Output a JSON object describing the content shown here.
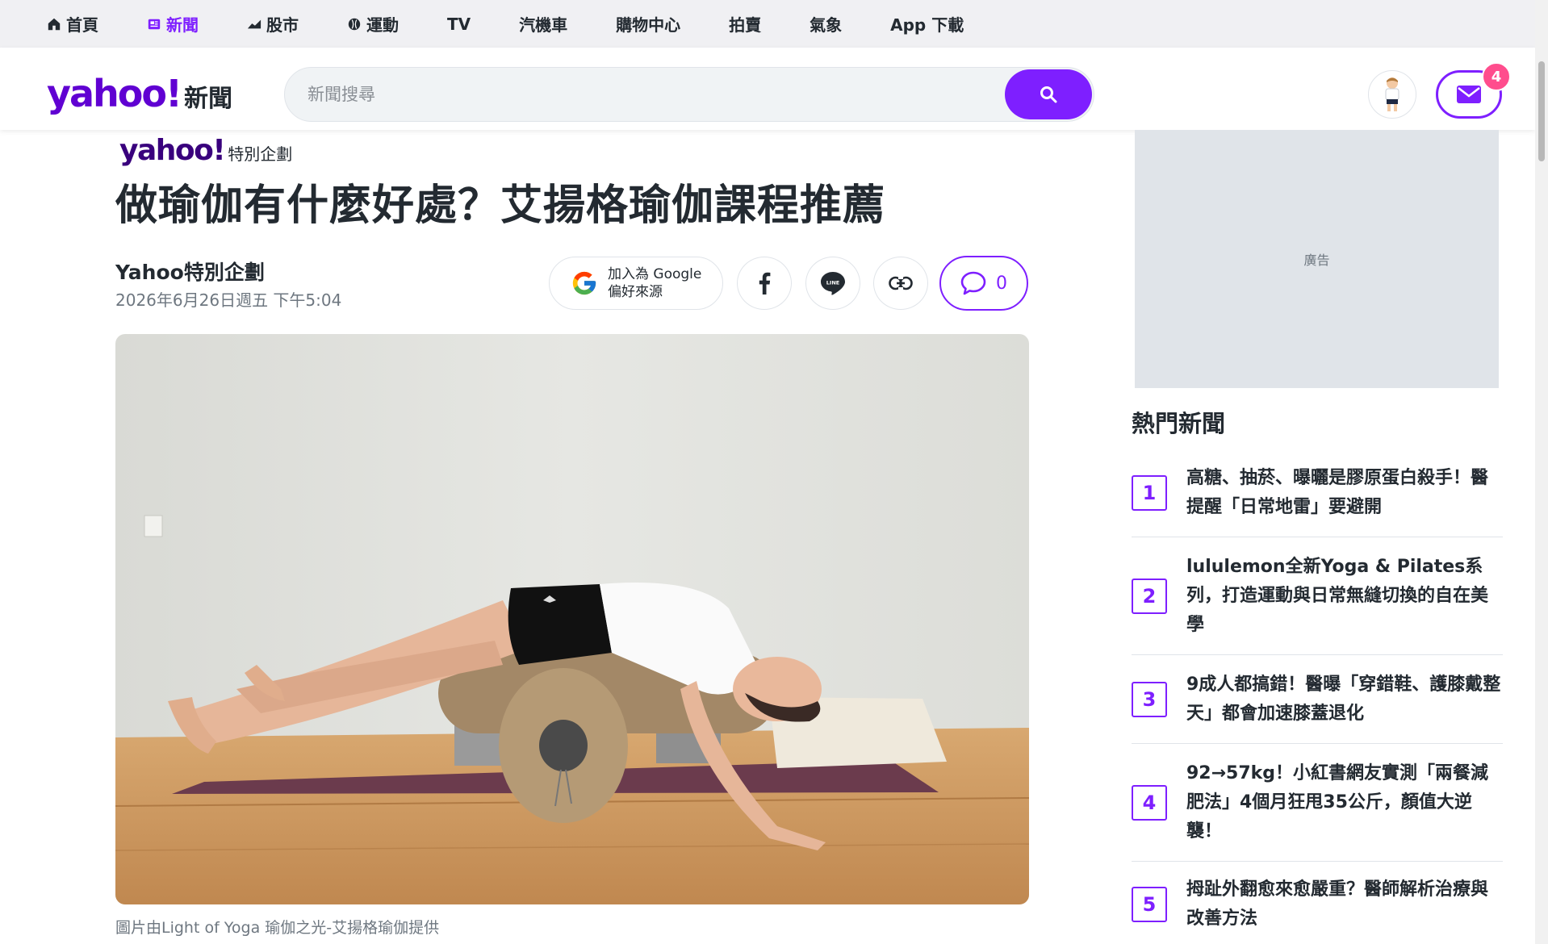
{
  "topnav": {
    "items": [
      {
        "label": "首頁",
        "icon": "home-icon"
      },
      {
        "label": "新聞",
        "icon": "news-icon",
        "active": true
      },
      {
        "label": "股市",
        "icon": "stock-chart-icon"
      },
      {
        "label": "運動",
        "icon": "sports-ball-icon"
      },
      {
        "label": "TV"
      },
      {
        "label": "汽機車"
      },
      {
        "label": "購物中心"
      },
      {
        "label": "拍賣"
      },
      {
        "label": "氣象"
      },
      {
        "label": "App 下載"
      }
    ]
  },
  "header": {
    "logo_text": "yahoo!",
    "logo_sub": "新聞",
    "search_placeholder": "新聞搜尋",
    "mail_badge": "4"
  },
  "article": {
    "brand_logo": "yahoo!",
    "brand_tag": "特別企劃",
    "title": "做瑜伽有什麼好處？艾揚格瑜伽課程推薦",
    "author": "Yahoo特別企劃",
    "date": "2026年6月26日週五 下午5:04",
    "google_line1": "加入為 Google",
    "google_line2": "偏好來源",
    "comment_count": "0",
    "caption": "圖片由Light of Yoga 瑜伽之光-艾揚格瑜伽提供"
  },
  "sidebar": {
    "ad_label": "廣告",
    "trending_title": "熱門新聞",
    "trending": [
      {
        "num": "1",
        "text": "高糖、抽菸、曝曬是膠原蛋白殺手！醫提醒「日常地雷」要避開"
      },
      {
        "num": "2",
        "text": "lululemon全新Yoga & Pilates系列，打造運動與日常無縫切換的自在美學"
      },
      {
        "num": "3",
        "text": "9成人都搞錯！醫曝「穿錯鞋、護膝戴整天」都會加速膝蓋退化"
      },
      {
        "num": "4",
        "text": "92→57kg！小紅書網友實測「兩餐減肥法」4個月狂甩35公斤，顏值大逆襲！"
      },
      {
        "num": "5",
        "text": "拇趾外翻愈來愈嚴重？醫師解析治療與改善方法"
      }
    ]
  },
  "colors": {
    "accent": "#7e1fff",
    "brand_purple": "#6001d2",
    "badge_pink": "#ff4d8d"
  }
}
